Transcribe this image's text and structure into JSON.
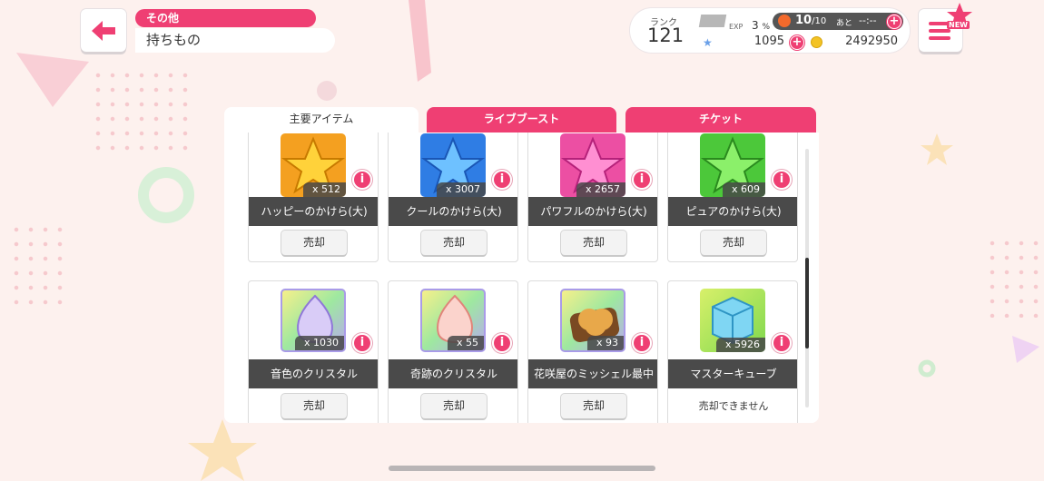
{
  "header": {
    "category": "その他",
    "title": "持ちもの"
  },
  "status": {
    "rank_label": "ランク",
    "rank_value": "121",
    "exp_label": "EXP",
    "exp_value": "3",
    "exp_unit": "%",
    "stamina_current": "10",
    "stamina_max": "/10",
    "stamina_ato": "あと",
    "stamina_timer": "--:--",
    "star_count": "1095",
    "coin_count": "2492950"
  },
  "menu": {
    "new_badge": "NEW"
  },
  "tabs": [
    {
      "label": "主要アイテム",
      "active": true
    },
    {
      "label": "ライブブースト",
      "active": false
    },
    {
      "label": "チケット",
      "active": false
    }
  ],
  "items_row1": [
    {
      "name": "ハッピーのかけら(大)",
      "qty": "x 512",
      "sell": "売却",
      "color": "#f4a020",
      "icon": "star-icon"
    },
    {
      "name": "クールのかけら(大)",
      "qty": "x 3007",
      "sell": "売却",
      "color": "#2f7de4",
      "icon": "star-icon"
    },
    {
      "name": "パワフルのかけら(大)",
      "qty": "x 2657",
      "sell": "売却",
      "color": "#ec4fa3",
      "icon": "star-icon"
    },
    {
      "name": "ピュアのかけら(大)",
      "qty": "x 609",
      "sell": "売却",
      "color": "#4cc83a",
      "icon": "star-icon"
    }
  ],
  "items_row2": [
    {
      "name": "音色のクリスタル",
      "qty": "x 1030",
      "sell": "売却",
      "color": "#c6a8ef",
      "icon": "crystal-icon"
    },
    {
      "name": "奇跡のクリスタル",
      "qty": "x 55",
      "sell": "売却",
      "color": "#f5a9a4",
      "icon": "crystal-icon"
    },
    {
      "name": "花咲屋のミッシェル最中",
      "qty": "x 93",
      "sell": "売却",
      "color": "#a86a2c",
      "icon": "monaka-icon"
    },
    {
      "name": "マスターキューブ",
      "qty": "x 5926",
      "sell_disabled": "売却できません",
      "color": "#58c3e8",
      "icon": "cube-icon"
    }
  ],
  "info_label": "i",
  "colors": {
    "accent": "#ef3f73",
    "name_bar": "#4a4a4a"
  }
}
